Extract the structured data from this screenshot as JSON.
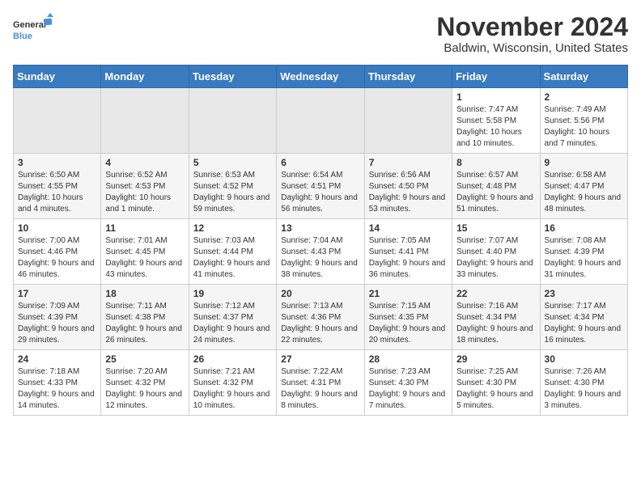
{
  "logo": {
    "general": "General",
    "blue": "Blue"
  },
  "header": {
    "month": "November 2024",
    "location": "Baldwin, Wisconsin, United States"
  },
  "columns": [
    "Sunday",
    "Monday",
    "Tuesday",
    "Wednesday",
    "Thursday",
    "Friday",
    "Saturday"
  ],
  "weeks": [
    {
      "days": [
        {
          "num": "",
          "content": "",
          "empty": true
        },
        {
          "num": "",
          "content": "",
          "empty": true
        },
        {
          "num": "",
          "content": "",
          "empty": true
        },
        {
          "num": "",
          "content": "",
          "empty": true
        },
        {
          "num": "",
          "content": "",
          "empty": true
        },
        {
          "num": "1",
          "content": "Sunrise: 7:47 AM\nSunset: 5:58 PM\nDaylight: 10 hours and 10 minutes.",
          "empty": false
        },
        {
          "num": "2",
          "content": "Sunrise: 7:49 AM\nSunset: 5:56 PM\nDaylight: 10 hours and 7 minutes.",
          "empty": false
        }
      ]
    },
    {
      "days": [
        {
          "num": "3",
          "content": "Sunrise: 6:50 AM\nSunset: 4:55 PM\nDaylight: 10 hours and 4 minutes.",
          "empty": false
        },
        {
          "num": "4",
          "content": "Sunrise: 6:52 AM\nSunset: 4:53 PM\nDaylight: 10 hours and 1 minute.",
          "empty": false
        },
        {
          "num": "5",
          "content": "Sunrise: 6:53 AM\nSunset: 4:52 PM\nDaylight: 9 hours and 59 minutes.",
          "empty": false
        },
        {
          "num": "6",
          "content": "Sunrise: 6:54 AM\nSunset: 4:51 PM\nDaylight: 9 hours and 56 minutes.",
          "empty": false
        },
        {
          "num": "7",
          "content": "Sunrise: 6:56 AM\nSunset: 4:50 PM\nDaylight: 9 hours and 53 minutes.",
          "empty": false
        },
        {
          "num": "8",
          "content": "Sunrise: 6:57 AM\nSunset: 4:48 PM\nDaylight: 9 hours and 51 minutes.",
          "empty": false
        },
        {
          "num": "9",
          "content": "Sunrise: 6:58 AM\nSunset: 4:47 PM\nDaylight: 9 hours and 48 minutes.",
          "empty": false
        }
      ]
    },
    {
      "days": [
        {
          "num": "10",
          "content": "Sunrise: 7:00 AM\nSunset: 4:46 PM\nDaylight: 9 hours and 46 minutes.",
          "empty": false
        },
        {
          "num": "11",
          "content": "Sunrise: 7:01 AM\nSunset: 4:45 PM\nDaylight: 9 hours and 43 minutes.",
          "empty": false
        },
        {
          "num": "12",
          "content": "Sunrise: 7:03 AM\nSunset: 4:44 PM\nDaylight: 9 hours and 41 minutes.",
          "empty": false
        },
        {
          "num": "13",
          "content": "Sunrise: 7:04 AM\nSunset: 4:43 PM\nDaylight: 9 hours and 38 minutes.",
          "empty": false
        },
        {
          "num": "14",
          "content": "Sunrise: 7:05 AM\nSunset: 4:41 PM\nDaylight: 9 hours and 36 minutes.",
          "empty": false
        },
        {
          "num": "15",
          "content": "Sunrise: 7:07 AM\nSunset: 4:40 PM\nDaylight: 9 hours and 33 minutes.",
          "empty": false
        },
        {
          "num": "16",
          "content": "Sunrise: 7:08 AM\nSunset: 4:39 PM\nDaylight: 9 hours and 31 minutes.",
          "empty": false
        }
      ]
    },
    {
      "days": [
        {
          "num": "17",
          "content": "Sunrise: 7:09 AM\nSunset: 4:39 PM\nDaylight: 9 hours and 29 minutes.",
          "empty": false
        },
        {
          "num": "18",
          "content": "Sunrise: 7:11 AM\nSunset: 4:38 PM\nDaylight: 9 hours and 26 minutes.",
          "empty": false
        },
        {
          "num": "19",
          "content": "Sunrise: 7:12 AM\nSunset: 4:37 PM\nDaylight: 9 hours and 24 minutes.",
          "empty": false
        },
        {
          "num": "20",
          "content": "Sunrise: 7:13 AM\nSunset: 4:36 PM\nDaylight: 9 hours and 22 minutes.",
          "empty": false
        },
        {
          "num": "21",
          "content": "Sunrise: 7:15 AM\nSunset: 4:35 PM\nDaylight: 9 hours and 20 minutes.",
          "empty": false
        },
        {
          "num": "22",
          "content": "Sunrise: 7:16 AM\nSunset: 4:34 PM\nDaylight: 9 hours and 18 minutes.",
          "empty": false
        },
        {
          "num": "23",
          "content": "Sunrise: 7:17 AM\nSunset: 4:34 PM\nDaylight: 9 hours and 16 minutes.",
          "empty": false
        }
      ]
    },
    {
      "days": [
        {
          "num": "24",
          "content": "Sunrise: 7:18 AM\nSunset: 4:33 PM\nDaylight: 9 hours and 14 minutes.",
          "empty": false
        },
        {
          "num": "25",
          "content": "Sunrise: 7:20 AM\nSunset: 4:32 PM\nDaylight: 9 hours and 12 minutes.",
          "empty": false
        },
        {
          "num": "26",
          "content": "Sunrise: 7:21 AM\nSunset: 4:32 PM\nDaylight: 9 hours and 10 minutes.",
          "empty": false
        },
        {
          "num": "27",
          "content": "Sunrise: 7:22 AM\nSunset: 4:31 PM\nDaylight: 9 hours and 8 minutes.",
          "empty": false
        },
        {
          "num": "28",
          "content": "Sunrise: 7:23 AM\nSunset: 4:30 PM\nDaylight: 9 hours and 7 minutes.",
          "empty": false
        },
        {
          "num": "29",
          "content": "Sunrise: 7:25 AM\nSunset: 4:30 PM\nDaylight: 9 hours and 5 minutes.",
          "empty": false
        },
        {
          "num": "30",
          "content": "Sunrise: 7:26 AM\nSunset: 4:30 PM\nDaylight: 9 hours and 3 minutes.",
          "empty": false
        }
      ]
    }
  ]
}
